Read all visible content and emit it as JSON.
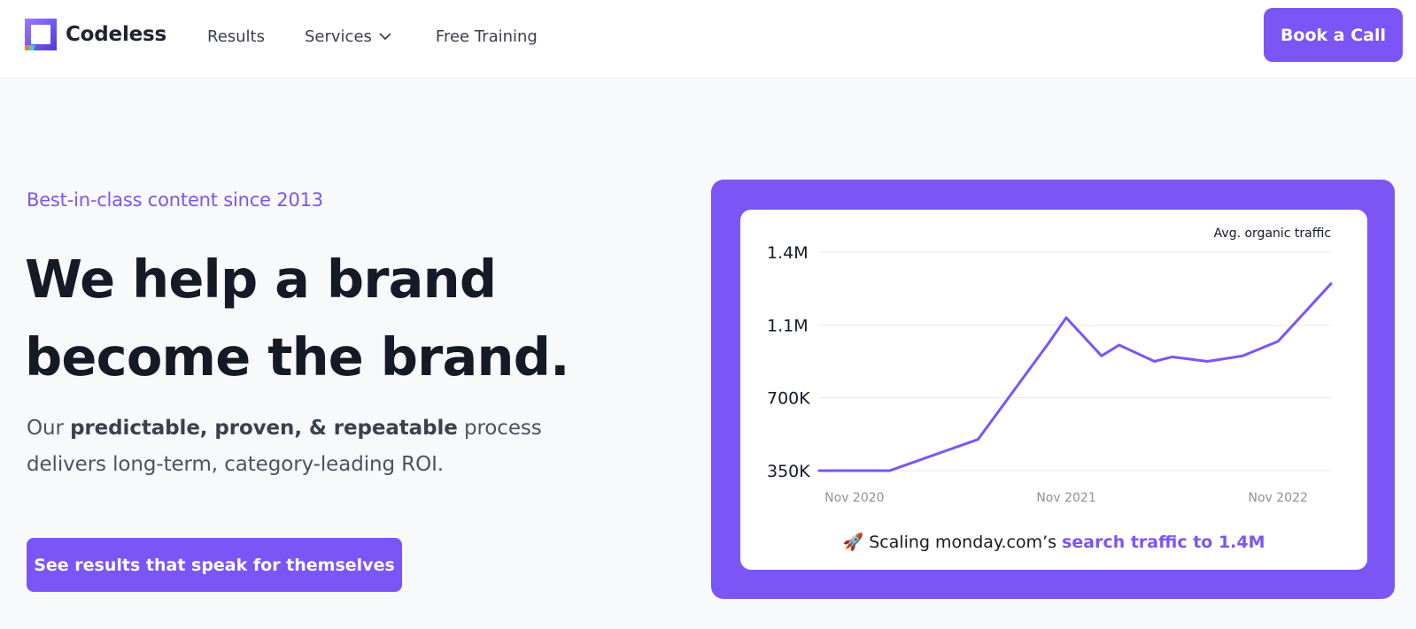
{
  "header": {
    "brand": "Codeless",
    "nav": {
      "results": "Results",
      "services": "Services",
      "free_training": "Free Training"
    },
    "cta": "Book a Call"
  },
  "hero": {
    "eyebrow": "Best-in-class content since 2013",
    "headline_line1": "We help a brand",
    "headline_line2": "become the brand.",
    "sub_pre": "Our ",
    "sub_bold": "predictable, proven, & repeatable",
    "sub_post": " process delivers long-term, category-leading ROI.",
    "cta": "See results that speak for themselves"
  },
  "colors": {
    "accent": "#7b55f5",
    "text_dark": "#141a26",
    "background": "#f8f9fb"
  },
  "icons": {
    "logo": "codeless-logo-icon",
    "dropdown": "chevron-down-icon",
    "caption": "rocket-emoji"
  },
  "chart_caption": {
    "emoji": "🚀",
    "pre": " Scaling monday.com’s ",
    "highlight": "search traffic to 1.4M"
  },
  "chart_data": {
    "type": "line",
    "legend_label": "Avg. organic traffic",
    "x_start": "2020-09",
    "x_end": "2023-02",
    "x_ticks": [
      {
        "date": "2020-11",
        "label": "Nov 2020"
      },
      {
        "date": "2021-11",
        "label": "Nov 2021"
      },
      {
        "date": "2022-11",
        "label": "Nov 2022"
      }
    ],
    "y_ticks": [
      {
        "value": 350000,
        "label": "350K"
      },
      {
        "value": 700000,
        "label": "700K"
      },
      {
        "value": 1100000,
        "label": "1.1M"
      },
      {
        "value": 1400000,
        "label": "1.4M"
      }
    ],
    "ylim": [
      350000,
      1400000
    ],
    "grid": true,
    "series": [
      {
        "color": "#7b55f5",
        "points": [
          {
            "date": "2020-09",
            "value": 350000
          },
          {
            "date": "2021-01",
            "value": 350000
          },
          {
            "date": "2021-06",
            "value": 500000
          },
          {
            "date": "2021-10",
            "value": 1000000
          },
          {
            "date": "2021-11",
            "value": 1130000
          },
          {
            "date": "2022-01",
            "value": 930000
          },
          {
            "date": "2022-02",
            "value": 990000
          },
          {
            "date": "2022-04",
            "value": 900000
          },
          {
            "date": "2022-05",
            "value": 925000
          },
          {
            "date": "2022-07",
            "value": 900000
          },
          {
            "date": "2022-09",
            "value": 930000
          },
          {
            "date": "2022-11",
            "value": 1010000
          },
          {
            "date": "2023-02",
            "value": 1270000
          }
        ]
      }
    ]
  }
}
